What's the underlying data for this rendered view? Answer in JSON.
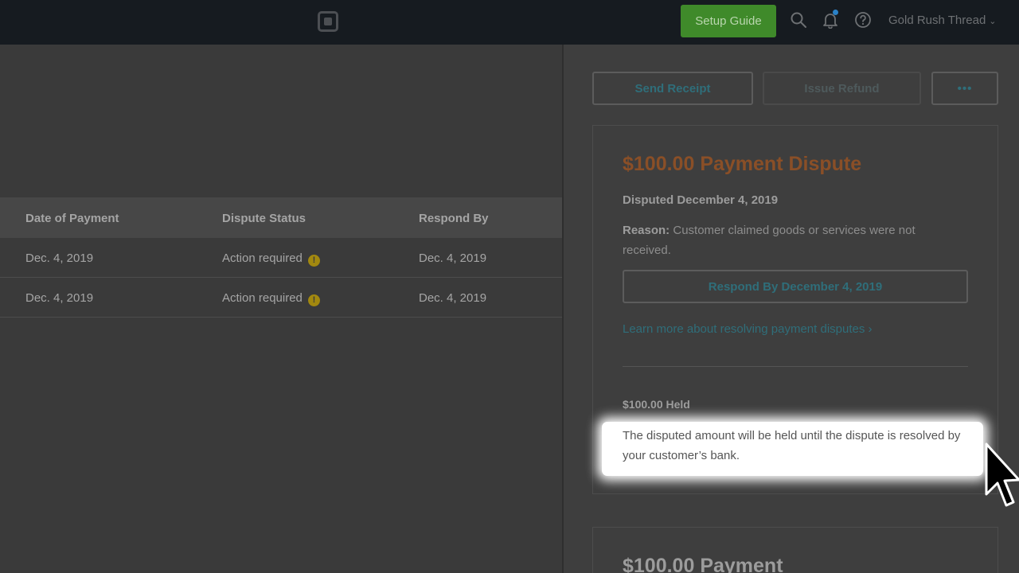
{
  "topbar": {
    "setup_guide_label": "Setup Guide",
    "account_name": "Gold Rush Thread",
    "colors": {
      "bar": "#161b20",
      "setup_button": "#3f8a2a"
    }
  },
  "table": {
    "columns": [
      "Date of Payment",
      "Dispute Status",
      "Respond By"
    ],
    "rows": [
      {
        "date": "Dec. 4, 2019",
        "status": "Action required",
        "respond_by": "Dec. 4, 2019"
      },
      {
        "date": "Dec. 4, 2019",
        "status": "Action required",
        "respond_by": "Dec. 4, 2019"
      }
    ]
  },
  "panel": {
    "send_receipt_label": "Send Receipt",
    "issue_refund_label": "Issue Refund",
    "more_label": "•••",
    "card": {
      "title": "$100.00 Payment Dispute",
      "disputed_date": "Disputed December 4, 2019",
      "reason_label": "Reason:",
      "reason_text": "Customer claimed goods or services were not received.",
      "respond_button_label": "Respond By December 4, 2019",
      "learn_more_label": "Learn more about resolving payment disputes",
      "held_label": "$100.00 Held",
      "held_description": "The disputed amount will be held until the dispute is resolved by your customer’s bank."
    },
    "card2": {
      "title": "$100.00 Payment"
    },
    "colors": {
      "title_accent": "#d97a3e",
      "link": "#2f6e7a"
    }
  }
}
